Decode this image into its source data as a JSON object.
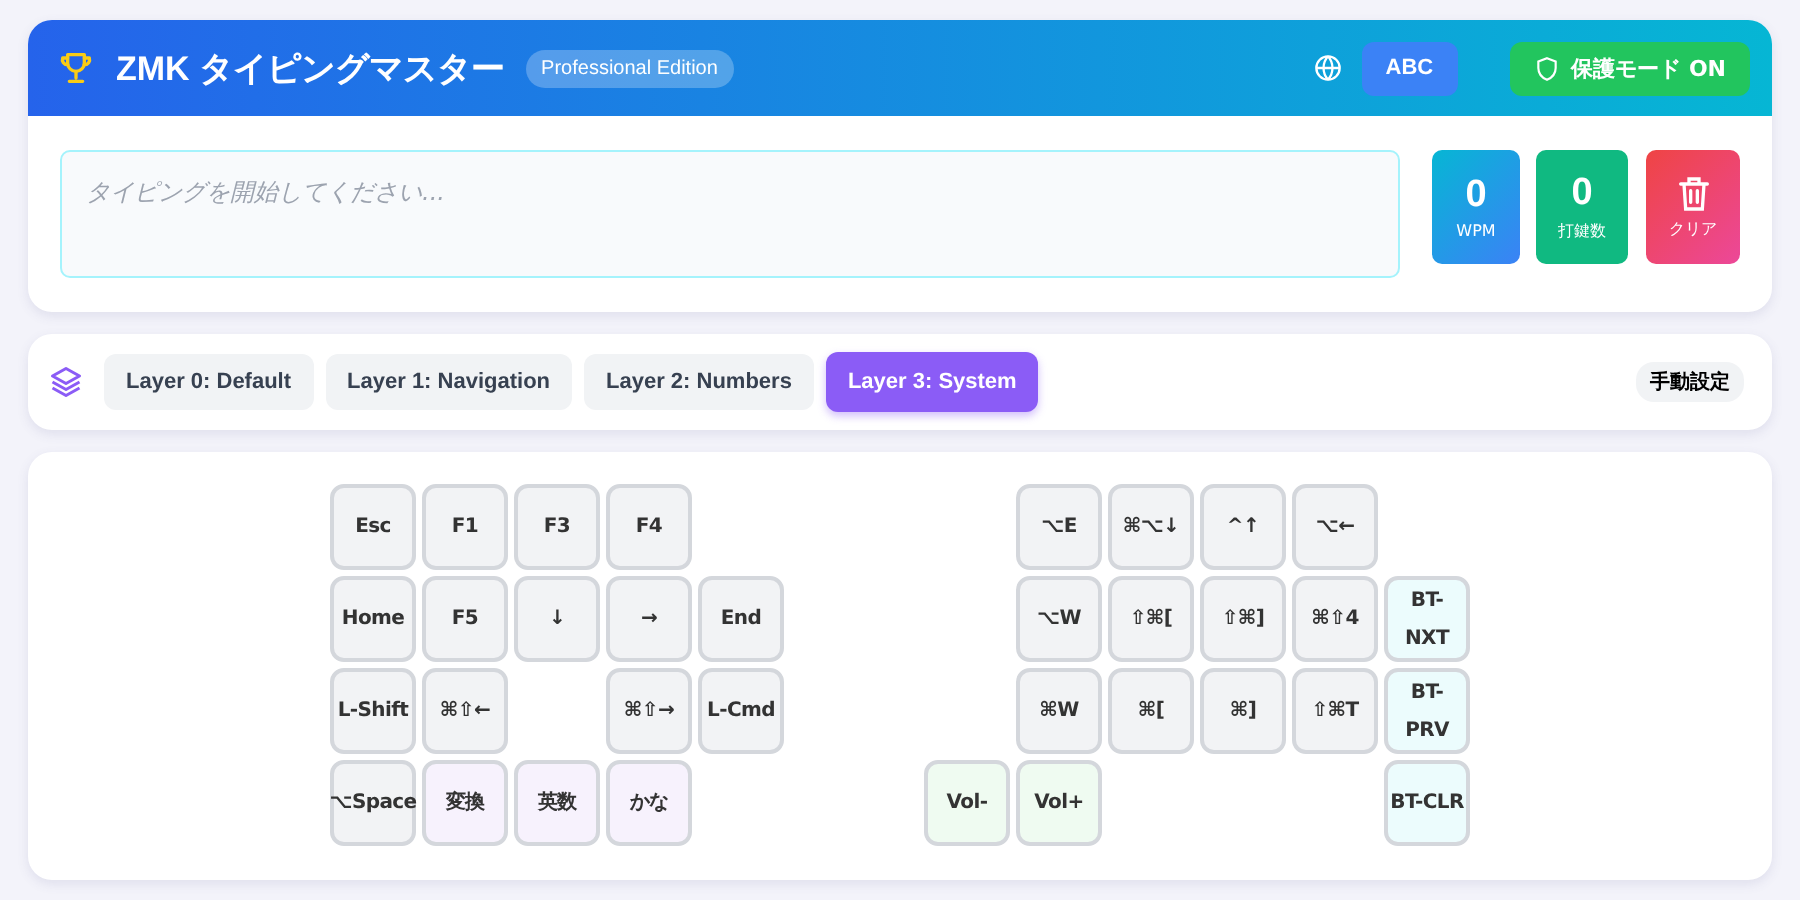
{
  "header": {
    "title": "ZMK タイピングマスター",
    "badge": "Professional Edition",
    "input_mode": "ABC",
    "protect_button": "保護モード ON"
  },
  "typing_field": {
    "placeholder": "タイピングを開始してください..."
  },
  "stats": [
    {
      "kind": "wpm",
      "value": "0",
      "label": "WPM"
    },
    {
      "kind": "count",
      "value": "0",
      "label": "打鍵数"
    },
    {
      "kind": "clear",
      "label": "クリア"
    }
  ],
  "layers": [
    {
      "label": "Layer 0: Default",
      "selected": false
    },
    {
      "label": "Layer 1: Navigation",
      "selected": false
    },
    {
      "label": "Layer 2: Numbers",
      "selected": false
    },
    {
      "label": "Layer 3: System",
      "selected": true
    }
  ],
  "mode_badge": "手動設定",
  "keyboard": {
    "left": [
      [
        {
          "kind": "key",
          "label": "Esc"
        },
        {
          "kind": "key",
          "label": "F1"
        },
        {
          "kind": "key",
          "label": "F3"
        },
        {
          "kind": "key",
          "label": "F4"
        },
        {
          "kind": "blank"
        }
      ],
      [
        {
          "kind": "key",
          "label": "Home"
        },
        {
          "kind": "key",
          "label": "F5"
        },
        {
          "kind": "key",
          "label": "↓"
        },
        {
          "kind": "key",
          "label": "→"
        },
        {
          "kind": "key",
          "label": "End"
        }
      ],
      [
        {
          "kind": "key",
          "label": "L-Shift"
        },
        {
          "kind": "key",
          "label": "⌘⇧←"
        },
        {
          "kind": "blank"
        },
        {
          "kind": "key",
          "label": "⌘⇧→"
        },
        {
          "kind": "key",
          "label": "L-Cmd"
        }
      ],
      [
        {
          "kind": "key",
          "label": "⌥Space"
        },
        {
          "kind": "lang",
          "label": "変換"
        },
        {
          "kind": "lang",
          "label": "英数"
        },
        {
          "kind": "lang",
          "label": "かな"
        },
        {
          "kind": "blank"
        }
      ]
    ],
    "right": [
      [
        {
          "kind": "blank"
        },
        {
          "kind": "key",
          "label": "⌥E"
        },
        {
          "kind": "key",
          "label": "⌘⌥↓"
        },
        {
          "kind": "key",
          "label": "^↑"
        },
        {
          "kind": "key",
          "label": "⌥←"
        },
        {
          "kind": "blank"
        }
      ],
      [
        {
          "kind": "blank"
        },
        {
          "kind": "key",
          "label": "⌥W"
        },
        {
          "kind": "key",
          "label": "⇧⌘["
        },
        {
          "kind": "key",
          "label": "⇧⌘]"
        },
        {
          "kind": "key",
          "label": "⌘⇧4"
        },
        {
          "kind": "bluetooth",
          "label": "BT-NXT"
        }
      ],
      [
        {
          "kind": "blank"
        },
        {
          "kind": "key",
          "label": "⌘W"
        },
        {
          "kind": "key",
          "label": "⌘["
        },
        {
          "kind": "key",
          "label": "⌘]"
        },
        {
          "kind": "key",
          "label": "⇧⌘T"
        },
        {
          "kind": "bluetooth",
          "label": "BT-PRV"
        }
      ],
      [
        {
          "kind": "media",
          "label": "Vol-"
        },
        {
          "kind": "media",
          "label": "Vol+"
        },
        {
          "kind": "blank"
        },
        {
          "kind": "blank"
        },
        {
          "kind": "blank"
        },
        {
          "kind": "bluetooth",
          "label": "BT-CLR"
        }
      ]
    ]
  }
}
